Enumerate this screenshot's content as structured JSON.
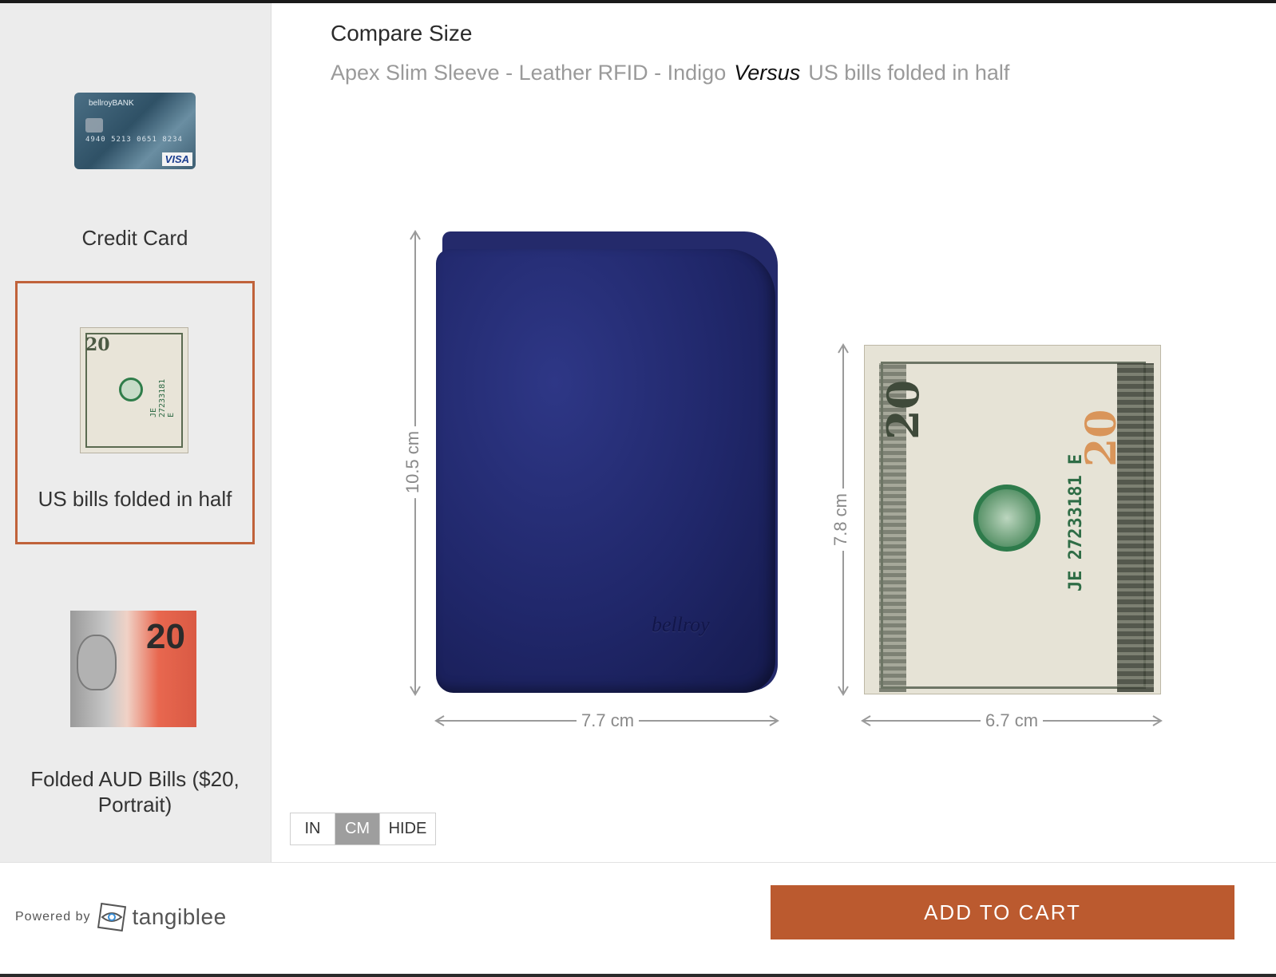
{
  "header": {
    "title": "Compare Size",
    "product_name": "Apex Slim Sleeve - Leather RFID - Indigo",
    "versus_label": "Versus",
    "comparison_item": "US bills folded in half"
  },
  "sidebar": {
    "items": [
      {
        "label": "Credit Card",
        "selected": false,
        "icon": "credit-card-image"
      },
      {
        "label": "US bills folded in half",
        "selected": true,
        "icon": "us-bill-image"
      },
      {
        "label": "Folded AUD Bills ($20, Portrait)",
        "selected": false,
        "icon": "aud-bill-image"
      }
    ],
    "selected_border_color": "#c0623a",
    "card_thumb": {
      "bank": "bellroyBANK",
      "number": "4940 5213 0651 8234",
      "network": "VISA"
    }
  },
  "comparison": {
    "wallet": {
      "height_label": "10.5 cm",
      "width_label": "7.7 cm",
      "brand": "bellroy",
      "color": "#20276a"
    },
    "bill": {
      "height_label": "7.8 cm",
      "width_label": "6.7 cm",
      "serial": "JE 27233181 E",
      "denomination": "20"
    }
  },
  "units": {
    "options": [
      "IN",
      "CM",
      "HIDE"
    ],
    "selected": "CM"
  },
  "footer": {
    "powered_by": "Powered by",
    "brand": "tangiblee",
    "cta": "ADD TO CART",
    "cta_color": "#bb5a2f"
  },
  "aud_thumb": {
    "denomination": "20"
  }
}
